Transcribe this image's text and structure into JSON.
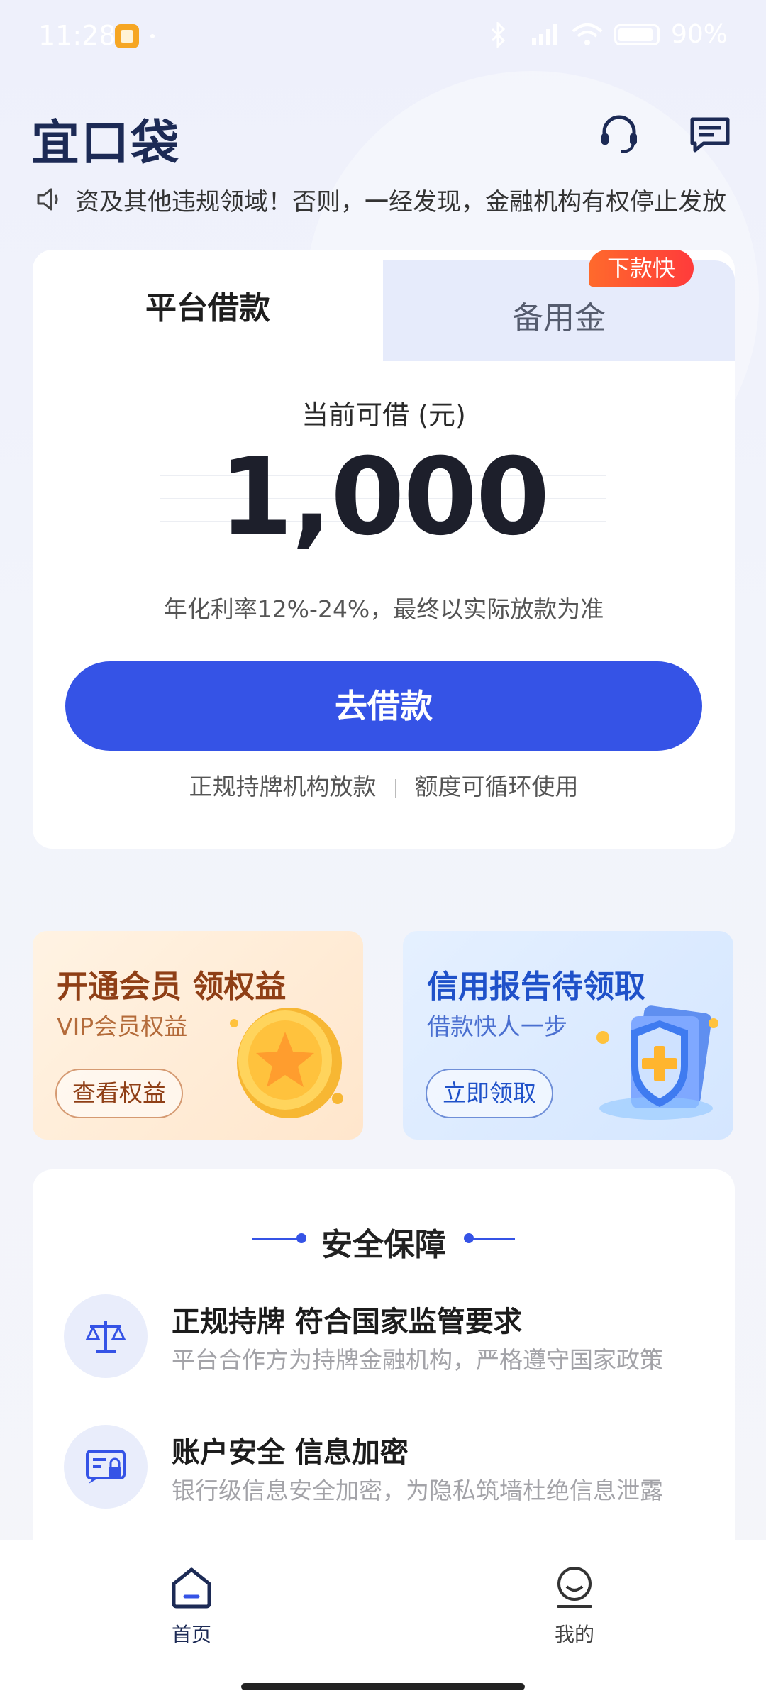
{
  "status_bar": {
    "time": "11:28",
    "battery": "90%"
  },
  "header": {
    "logo": "宜口袋"
  },
  "notice": {
    "text": "资及其他违规领域！否则，一经发现，金融机构有权停止发放"
  },
  "loan_card": {
    "tabs": [
      {
        "label": "平台借款",
        "active": true
      },
      {
        "label": "备用金",
        "active": false
      }
    ],
    "badge": "下款快",
    "available_label": "当前可借 (元)",
    "amount": "1,000",
    "rate_text": "年化利率12%-24%，最终以实际放款为准",
    "borrow_button": "去借款",
    "features": [
      "正规持牌机构放款",
      "额度可循环使用"
    ]
  },
  "promos": [
    {
      "title": "开通会员 领权益",
      "subtitle": "VIP会员权益",
      "button": "查看权益"
    },
    {
      "title": "信用报告待领取",
      "subtitle": "借款快人一步",
      "button": "立即领取"
    }
  ],
  "security": {
    "title": "安全保障",
    "items": [
      {
        "heading": "正规持牌 符合国家监管要求",
        "desc": "平台合作方为持牌金融机构，严格遵守国家政策",
        "icon": "scale-icon"
      },
      {
        "heading": "账户安全 信息加密",
        "desc": "银行级信息安全加密，为隐私筑墙杜绝信息泄露",
        "icon": "secure-id-icon"
      }
    ]
  },
  "bottom_nav": [
    {
      "label": "首页",
      "icon": "home-icon",
      "active": true
    },
    {
      "label": "我的",
      "icon": "profile-icon",
      "active": false
    }
  ],
  "colors": {
    "primary": "#3553e6",
    "badge": "#ff4d2e",
    "logo": "#1c2a55"
  }
}
